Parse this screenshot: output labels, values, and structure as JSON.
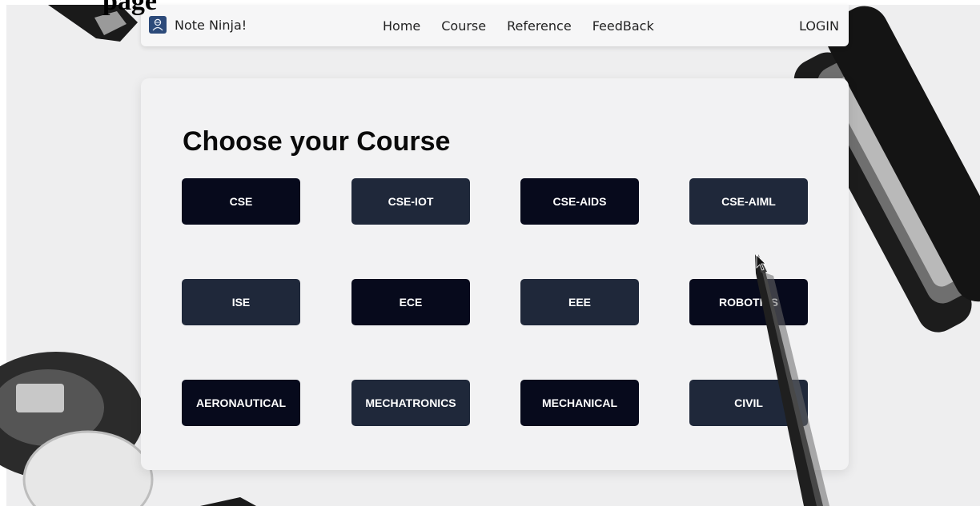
{
  "doc_heading": "page",
  "navbar": {
    "brand": "Note Ninja!",
    "links": [
      "Home",
      "Course",
      "Reference",
      "FeedBack"
    ],
    "login": "LOGIN"
  },
  "main": {
    "title": "Choose your Course",
    "courses": [
      "CSE",
      "CSE-IOT",
      "CSE-AIDS",
      "CSE-AIML",
      "ISE",
      "ECE",
      "EEE",
      "ROBOTICS",
      "AERONAUTICAL",
      "MECHATRONICS",
      "MECHANICAL",
      "CIVIL"
    ]
  },
  "colors": {
    "button_dark": "#070a1c",
    "button_slate": "#1f283a",
    "card_background": "#f2f2f3",
    "brand_icon": "#2c4a7a"
  }
}
